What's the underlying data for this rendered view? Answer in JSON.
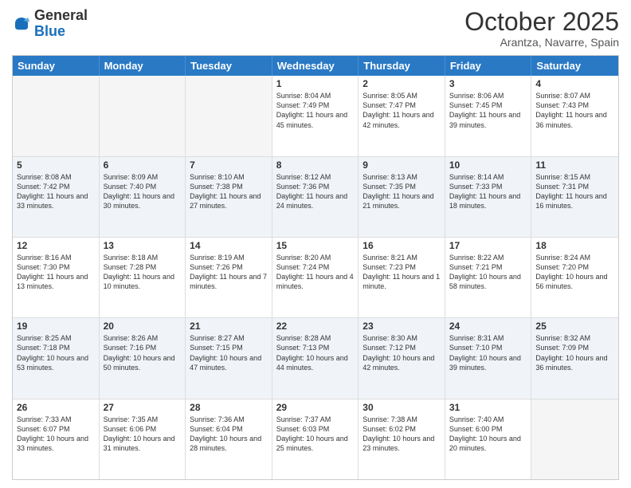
{
  "header": {
    "logo_general": "General",
    "logo_blue": "Blue",
    "month": "October 2025",
    "location": "Arantza, Navarre, Spain"
  },
  "days_of_week": [
    "Sunday",
    "Monday",
    "Tuesday",
    "Wednesday",
    "Thursday",
    "Friday",
    "Saturday"
  ],
  "rows": [
    {
      "alt": false,
      "cells": [
        {
          "day": "",
          "empty": true
        },
        {
          "day": "",
          "empty": true
        },
        {
          "day": "",
          "empty": true
        },
        {
          "day": "1",
          "sunrise": "Sunrise: 8:04 AM",
          "sunset": "Sunset: 7:49 PM",
          "daylight": "Daylight: 11 hours and 45 minutes."
        },
        {
          "day": "2",
          "sunrise": "Sunrise: 8:05 AM",
          "sunset": "Sunset: 7:47 PM",
          "daylight": "Daylight: 11 hours and 42 minutes."
        },
        {
          "day": "3",
          "sunrise": "Sunrise: 8:06 AM",
          "sunset": "Sunset: 7:45 PM",
          "daylight": "Daylight: 11 hours and 39 minutes."
        },
        {
          "day": "4",
          "sunrise": "Sunrise: 8:07 AM",
          "sunset": "Sunset: 7:43 PM",
          "daylight": "Daylight: 11 hours and 36 minutes."
        }
      ]
    },
    {
      "alt": true,
      "cells": [
        {
          "day": "5",
          "sunrise": "Sunrise: 8:08 AM",
          "sunset": "Sunset: 7:42 PM",
          "daylight": "Daylight: 11 hours and 33 minutes."
        },
        {
          "day": "6",
          "sunrise": "Sunrise: 8:09 AM",
          "sunset": "Sunset: 7:40 PM",
          "daylight": "Daylight: 11 hours and 30 minutes."
        },
        {
          "day": "7",
          "sunrise": "Sunrise: 8:10 AM",
          "sunset": "Sunset: 7:38 PM",
          "daylight": "Daylight: 11 hours and 27 minutes."
        },
        {
          "day": "8",
          "sunrise": "Sunrise: 8:12 AM",
          "sunset": "Sunset: 7:36 PM",
          "daylight": "Daylight: 11 hours and 24 minutes."
        },
        {
          "day": "9",
          "sunrise": "Sunrise: 8:13 AM",
          "sunset": "Sunset: 7:35 PM",
          "daylight": "Daylight: 11 hours and 21 minutes."
        },
        {
          "day": "10",
          "sunrise": "Sunrise: 8:14 AM",
          "sunset": "Sunset: 7:33 PM",
          "daylight": "Daylight: 11 hours and 18 minutes."
        },
        {
          "day": "11",
          "sunrise": "Sunrise: 8:15 AM",
          "sunset": "Sunset: 7:31 PM",
          "daylight": "Daylight: 11 hours and 16 minutes."
        }
      ]
    },
    {
      "alt": false,
      "cells": [
        {
          "day": "12",
          "sunrise": "Sunrise: 8:16 AM",
          "sunset": "Sunset: 7:30 PM",
          "daylight": "Daylight: 11 hours and 13 minutes."
        },
        {
          "day": "13",
          "sunrise": "Sunrise: 8:18 AM",
          "sunset": "Sunset: 7:28 PM",
          "daylight": "Daylight: 11 hours and 10 minutes."
        },
        {
          "day": "14",
          "sunrise": "Sunrise: 8:19 AM",
          "sunset": "Sunset: 7:26 PM",
          "daylight": "Daylight: 11 hours and 7 minutes."
        },
        {
          "day": "15",
          "sunrise": "Sunrise: 8:20 AM",
          "sunset": "Sunset: 7:24 PM",
          "daylight": "Daylight: 11 hours and 4 minutes."
        },
        {
          "day": "16",
          "sunrise": "Sunrise: 8:21 AM",
          "sunset": "Sunset: 7:23 PM",
          "daylight": "Daylight: 11 hours and 1 minute."
        },
        {
          "day": "17",
          "sunrise": "Sunrise: 8:22 AM",
          "sunset": "Sunset: 7:21 PM",
          "daylight": "Daylight: 10 hours and 58 minutes."
        },
        {
          "day": "18",
          "sunrise": "Sunrise: 8:24 AM",
          "sunset": "Sunset: 7:20 PM",
          "daylight": "Daylight: 10 hours and 56 minutes."
        }
      ]
    },
    {
      "alt": true,
      "cells": [
        {
          "day": "19",
          "sunrise": "Sunrise: 8:25 AM",
          "sunset": "Sunset: 7:18 PM",
          "daylight": "Daylight: 10 hours and 53 minutes."
        },
        {
          "day": "20",
          "sunrise": "Sunrise: 8:26 AM",
          "sunset": "Sunset: 7:16 PM",
          "daylight": "Daylight: 10 hours and 50 minutes."
        },
        {
          "day": "21",
          "sunrise": "Sunrise: 8:27 AM",
          "sunset": "Sunset: 7:15 PM",
          "daylight": "Daylight: 10 hours and 47 minutes."
        },
        {
          "day": "22",
          "sunrise": "Sunrise: 8:28 AM",
          "sunset": "Sunset: 7:13 PM",
          "daylight": "Daylight: 10 hours and 44 minutes."
        },
        {
          "day": "23",
          "sunrise": "Sunrise: 8:30 AM",
          "sunset": "Sunset: 7:12 PM",
          "daylight": "Daylight: 10 hours and 42 minutes."
        },
        {
          "day": "24",
          "sunrise": "Sunrise: 8:31 AM",
          "sunset": "Sunset: 7:10 PM",
          "daylight": "Daylight: 10 hours and 39 minutes."
        },
        {
          "day": "25",
          "sunrise": "Sunrise: 8:32 AM",
          "sunset": "Sunset: 7:09 PM",
          "daylight": "Daylight: 10 hours and 36 minutes."
        }
      ]
    },
    {
      "alt": false,
      "cells": [
        {
          "day": "26",
          "sunrise": "Sunrise: 7:33 AM",
          "sunset": "Sunset: 6:07 PM",
          "daylight": "Daylight: 10 hours and 33 minutes."
        },
        {
          "day": "27",
          "sunrise": "Sunrise: 7:35 AM",
          "sunset": "Sunset: 6:06 PM",
          "daylight": "Daylight: 10 hours and 31 minutes."
        },
        {
          "day": "28",
          "sunrise": "Sunrise: 7:36 AM",
          "sunset": "Sunset: 6:04 PM",
          "daylight": "Daylight: 10 hours and 28 minutes."
        },
        {
          "day": "29",
          "sunrise": "Sunrise: 7:37 AM",
          "sunset": "Sunset: 6:03 PM",
          "daylight": "Daylight: 10 hours and 25 minutes."
        },
        {
          "day": "30",
          "sunrise": "Sunrise: 7:38 AM",
          "sunset": "Sunset: 6:02 PM",
          "daylight": "Daylight: 10 hours and 23 minutes."
        },
        {
          "day": "31",
          "sunrise": "Sunrise: 7:40 AM",
          "sunset": "Sunset: 6:00 PM",
          "daylight": "Daylight: 10 hours and 20 minutes."
        },
        {
          "day": "",
          "empty": true
        }
      ]
    }
  ]
}
